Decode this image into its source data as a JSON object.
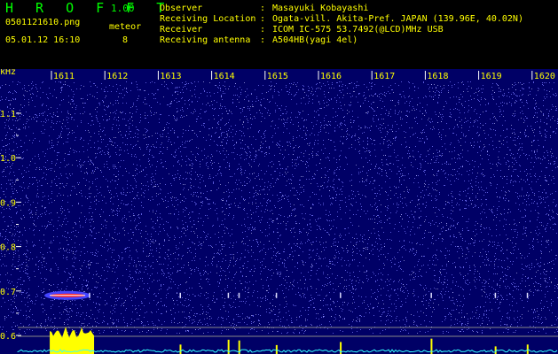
{
  "header": {
    "app_name": "H R O F F T",
    "version": "1.00",
    "filename": "0501121610.png",
    "datetime": "05.01.12 16:10",
    "meteor_label": "meteor",
    "meteor_count": "8"
  },
  "info": [
    {
      "label": "Observer",
      "sep": ":",
      "value": "Masayuki Kobayashi"
    },
    {
      "label": "Receiving Location",
      "sep": ":",
      "value": "Ogata-vill. Akita-Pref. JAPAN (139.96E, 40.02N)"
    },
    {
      "label": "Receiver",
      "sep": ":",
      "value": "ICOM IC-575 53.7492(@LCD)MHz USB"
    },
    {
      "label": "Receiving antenna",
      "sep": ":",
      "value": "A504HB(yagi 4el)"
    }
  ],
  "plot": {
    "unit": "kHz",
    "time_ticks": [
      "1611",
      "1612",
      "1613",
      "1614",
      "1615",
      "1616",
      "1617",
      "1618",
      "1619",
      "1620"
    ],
    "freq_ticks": [
      "1.1",
      "1.0",
      "0.9",
      "0.8",
      "0.7",
      "0.6"
    ],
    "colors": {
      "background": "#000066",
      "noise_dot": "#7777ff",
      "tick_text": "#ffff00",
      "trace_yellow": "#ffff00",
      "trace_cyan": "#33ffff",
      "meteor_red": "#ff2222"
    },
    "meteor_times": [
      1611.3,
      1611.7,
      1613.4,
      1614.3,
      1614.5,
      1615.2,
      1616.4,
      1618.1,
      1619.3,
      1619.9
    ]
  }
}
